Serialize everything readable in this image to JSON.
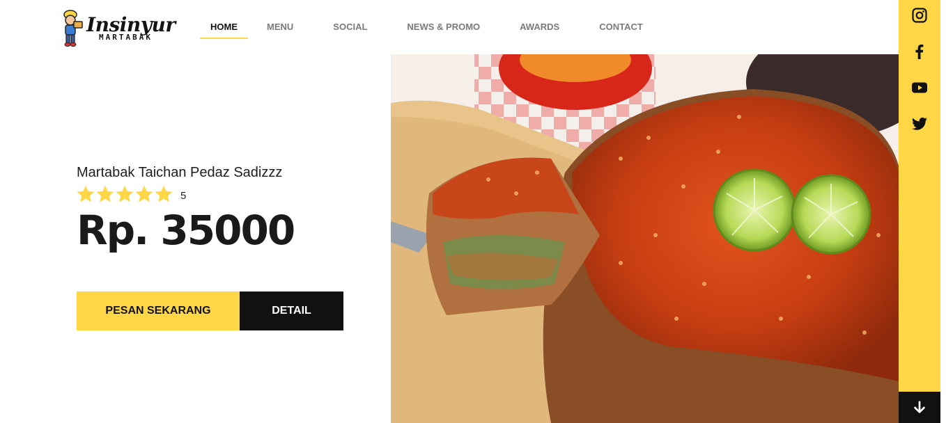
{
  "brand": {
    "title": "Insinyur",
    "subtitle": "MARTABAK"
  },
  "nav": {
    "items": [
      {
        "label": "HOME",
        "active": true
      },
      {
        "label": "MENU",
        "active": false
      },
      {
        "label": "SOCIAL",
        "active": false
      },
      {
        "label": "NEWS & PROMO",
        "active": false
      },
      {
        "label": "AWARDS",
        "active": false
      },
      {
        "label": "CONTACT",
        "active": false
      }
    ]
  },
  "social": {
    "icons": [
      "instagram-icon",
      "facebook-icon",
      "youtube-icon",
      "twitter-icon"
    ],
    "scroll_icon": "arrow-down-icon"
  },
  "hero": {
    "product_name": "Martabak Taichan Pedaz Sadizzz",
    "rating_value": "5",
    "stars": 5,
    "price": "Rp. 35000",
    "order_button": "PESAN SEKARANG",
    "detail_button": "DETAIL"
  },
  "colors": {
    "accent": "#ffd645",
    "dark": "#111111",
    "nav_inactive": "#7a7a7a"
  }
}
